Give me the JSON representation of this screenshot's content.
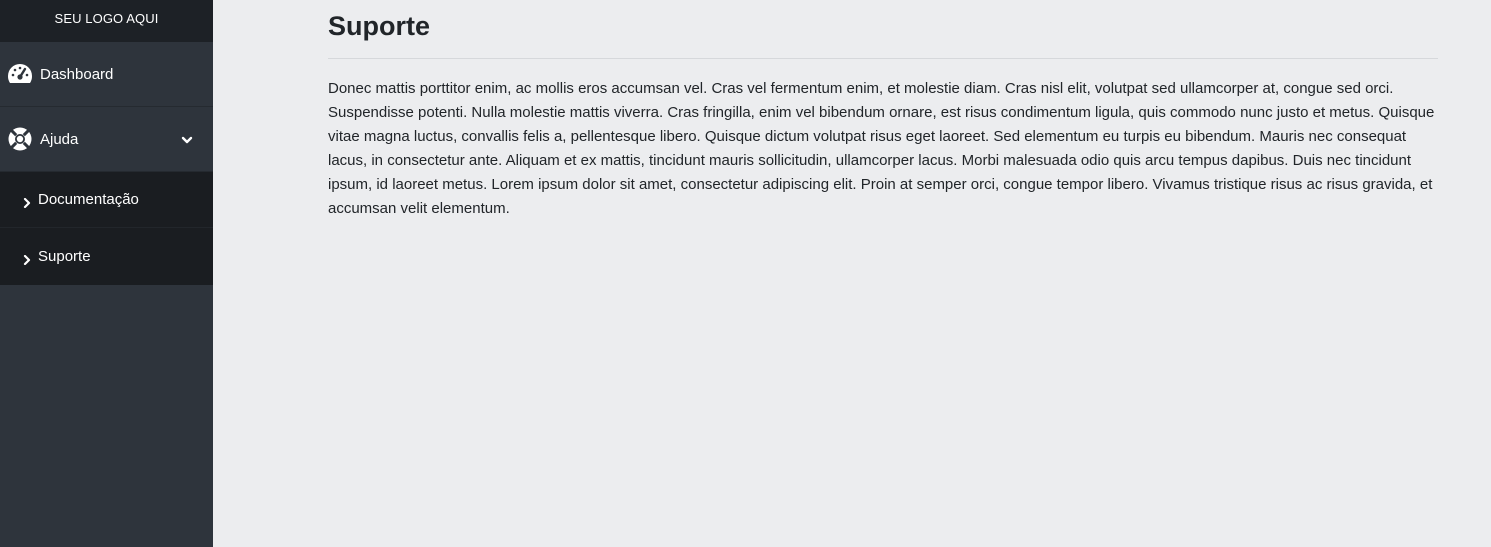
{
  "sidebar": {
    "logo": "SEU LOGO AQUI",
    "items": [
      {
        "label": "Dashboard",
        "icon": "tachometer-icon"
      },
      {
        "label": "Ajuda",
        "icon": "life-ring-icon",
        "expanded": true
      }
    ],
    "submenu": [
      {
        "label": "Documentação",
        "icon": "chevron-right-icon"
      },
      {
        "label": "Suporte",
        "icon": "chevron-right-icon"
      }
    ]
  },
  "main": {
    "title": "Suporte",
    "body": "Donec mattis porttitor enim, ac mollis eros accumsan vel. Cras vel fermentum enim, et molestie diam. Cras nisl elit, volutpat sed ullamcorper at, congue sed orci. Suspendisse potenti. Nulla molestie mattis viverra. Cras fringilla, enim vel bibendum ornare, est risus condimentum ligula, quis commodo nunc justo et metus. Quisque vitae magna luctus, convallis felis a, pellentesque libero. Quisque dictum volutpat risus eget laoreet. Sed elementum eu turpis eu bibendum. Mauris nec consequat lacus, in consectetur ante. Aliquam et ex mattis, tincidunt mauris sollicitudin, ullamcorper lacus. Morbi malesuada odio quis arcu tempus dapibus. Duis nec tincidunt ipsum, id laoreet metus. Lorem ipsum dolor sit amet, consectetur adipiscing elit. Proin at semper orci, congue tempor libero. Vivamus tristique risus ac risus gravida, et accumsan velit elementum."
  },
  "colors": {
    "sidebar_bg": "#2e343c",
    "logo_bg": "#1d2126",
    "submenu_bg": "#1a1d21",
    "page_bg": "#ecedef",
    "text": "#212529"
  }
}
